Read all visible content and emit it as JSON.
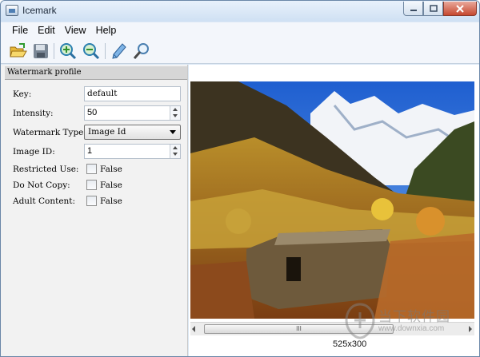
{
  "window": {
    "title": "Icemark"
  },
  "menu": [
    {
      "label": "File"
    },
    {
      "label": "Edit"
    },
    {
      "label": "View"
    },
    {
      "label": "Help"
    }
  ],
  "toolbar": {
    "icons": [
      "open-folder-icon",
      "save-icon",
      "zoom-in-icon",
      "zoom-out-icon",
      "pencil-icon",
      "search-icon"
    ]
  },
  "profile": {
    "header": "Watermark profile",
    "key_label": "Key:",
    "key_value": "default",
    "intensity_label": "Intensity:",
    "intensity_value": "50",
    "type_label": "Watermark Type:",
    "type_value": "Image Id",
    "image_id_label": "Image ID:",
    "image_id_value": "1",
    "restricted_label": "Restricted Use:",
    "restricted_value": "False",
    "no_copy_label": "Do Not Copy:",
    "no_copy_value": "False",
    "adult_label": "Adult Content:",
    "adult_value": "False"
  },
  "image": {
    "dimensions": "525x300",
    "scroll_grip": "III"
  },
  "brand": {
    "name": "当下软件园",
    "url": "www.downxia.com"
  }
}
